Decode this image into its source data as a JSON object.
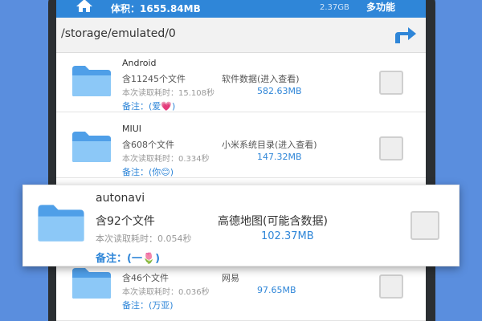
{
  "topbar": {
    "home_icon": "home-icon",
    "volume": "体积：1655.84MB",
    "free": "2.37GB",
    "more": "多功能"
  },
  "pathbar": {
    "path": "/storage/emulated/0",
    "up_icon": "up-arrow-icon"
  },
  "items": [
    {
      "name": "Android",
      "count": "含11245个文件",
      "desc": "软件数据(进入查看)",
      "time": "本次读取耗时：15.108秒",
      "size": "582.63MB",
      "note": "备注：(爱💗)"
    },
    {
      "name": "MIUI",
      "count": "含608个文件",
      "desc": "小米系统目录(进入查看)",
      "time": "本次读取耗时：0.334秒",
      "size": "147.32MB",
      "note": "备注：(你😊)"
    },
    {
      "name": "",
      "count": "含46个文件",
      "desc": "网易",
      "time": "本次读取耗时：0.036秒",
      "size": "97.65MB",
      "note": "备注：(万亚)"
    }
  ],
  "card": {
    "name": "autonavi",
    "count": "含92个文件",
    "desc": "高德地图(可能含数据)",
    "time": "本次读取耗时：0.054秒",
    "size": "102.37MB",
    "note": "备注：(一🌷)"
  },
  "colors": {
    "accent": "#2f86d8",
    "background": "#5a8ede",
    "folder": "#5aa9ee"
  }
}
